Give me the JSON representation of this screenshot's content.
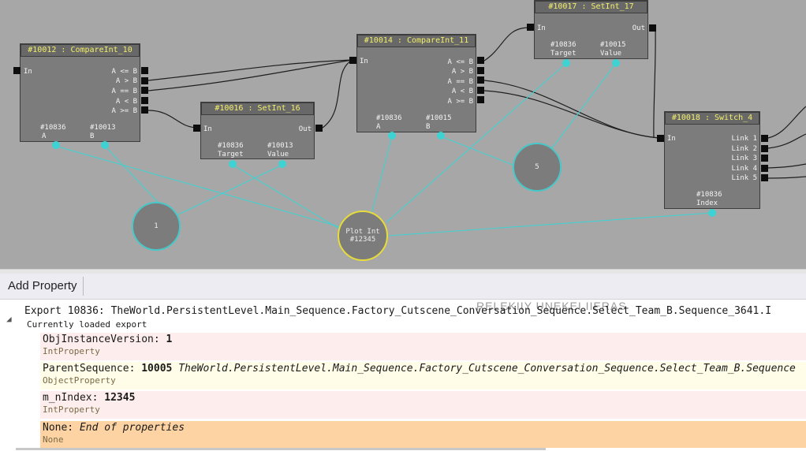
{
  "graph": {
    "nodes": [
      {
        "title": "#10012 : CompareInt_10",
        "input": "In",
        "outputs": [
          "A <= B",
          "A > B",
          "A == B",
          "A < B",
          "A >= B"
        ],
        "vars": [
          {
            "id": "#10836",
            "name": "A"
          },
          {
            "id": "#10013",
            "name": "B"
          }
        ]
      },
      {
        "title": "#10016 : SetInt_16",
        "input": "In",
        "outputs": [
          "Out"
        ],
        "vars": [
          {
            "id": "#10836",
            "name": "Target"
          },
          {
            "id": "#10013",
            "name": "Value"
          }
        ]
      },
      {
        "title": "#10014 : CompareInt_11",
        "input": "In",
        "outputs": [
          "A <= B",
          "A > B",
          "A == B",
          "A < B",
          "A >= B"
        ],
        "vars": [
          {
            "id": "#10836",
            "name": "A"
          },
          {
            "id": "#10015",
            "name": "B"
          }
        ]
      },
      {
        "title": "#10017 : SetInt_17",
        "input": "In",
        "outputs": [
          "Out"
        ],
        "vars": [
          {
            "id": "#10836",
            "name": "Target"
          },
          {
            "id": "#10015",
            "name": "Value"
          }
        ]
      },
      {
        "title": "#10018 : Switch_4",
        "input": "In",
        "outputs": [
          "Link 1",
          "Link 2",
          "Link 3",
          "Link 4",
          "Link 5"
        ],
        "vars": [
          {
            "id": "#10836",
            "name": "Index"
          }
        ]
      }
    ],
    "var_circles": [
      {
        "label": "1"
      },
      {
        "label": "5"
      },
      {
        "label_line1": "Plot Int",
        "label_line2": "#12345"
      }
    ]
  },
  "toolbar": {
    "add_property": "Add Property"
  },
  "properties": {
    "export_header": "Export 10836: TheWorld.PersistentLevel.Main_Sequence.Factory_Cutscene_Conversation_Sequence.Select_Team_B.Sequence_3641.I",
    "export_sub": "Currently loaded export",
    "ghost_text": "RELEKIIY UNEKEI IIERAS",
    "rows": [
      {
        "name": "ObjInstanceVersion:",
        "value": "1",
        "extra": "",
        "type": "IntProperty"
      },
      {
        "name": "ParentSequence:",
        "value": "10005",
        "extra": "TheWorld.PersistentLevel.Main_Sequence.Factory_Cutscene_Conversation_Sequence.Select_Team_B.Sequence",
        "type": "ObjectProperty"
      },
      {
        "name": "m_nIndex:",
        "value": "12345",
        "extra": "",
        "type": "IntProperty"
      },
      {
        "name": "None:",
        "value": "",
        "extra": "End of properties",
        "type": "None"
      }
    ]
  },
  "colors": {
    "canvas_bg": "#a7a7a7",
    "node_body": "#7c7c7c",
    "node_title_text": "#f4f06a",
    "variable_link": "#3fd2d2",
    "plot_circle_border": "#e6dc3a",
    "row_pink": "#fdeeed",
    "row_cream": "#fffde7",
    "row_orange": "#fdd3a3"
  }
}
